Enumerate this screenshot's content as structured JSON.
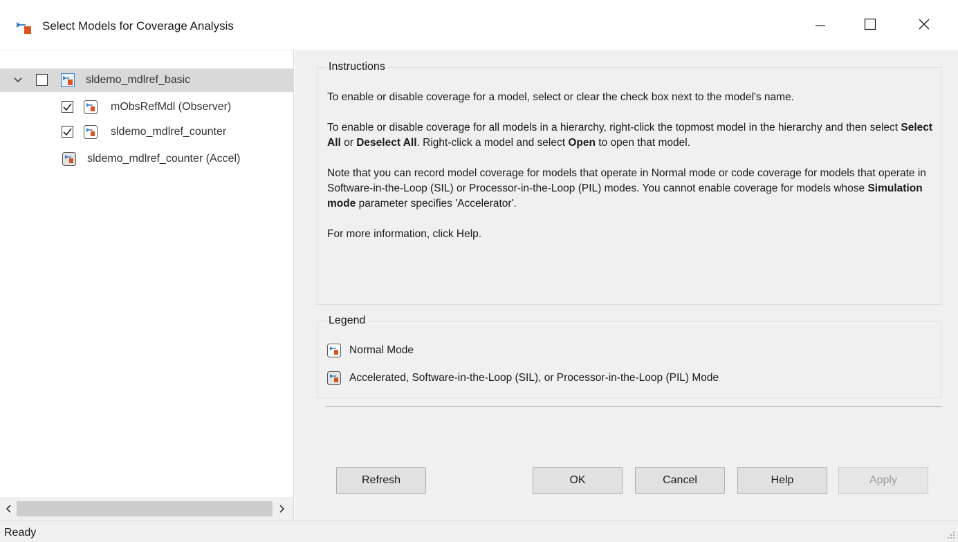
{
  "window": {
    "title": "Select Models for Coverage Analysis"
  },
  "tree": {
    "items": [
      {
        "label": "sldemo_mdlref_basic",
        "checked": false,
        "expanded": true,
        "mode": "normal",
        "selected": true
      },
      {
        "label": "mObsRefMdl (Observer)",
        "checked": true,
        "mode": "normal"
      },
      {
        "label": "sldemo_mdlref_counter",
        "checked": true,
        "mode": "normal"
      },
      {
        "label": "sldemo_mdlref_counter (Accel)",
        "checked": null,
        "mode": "accelerated"
      }
    ]
  },
  "instructions": {
    "title": "Instructions",
    "p1": "To enable or disable coverage for a model, select or clear the check box next to the model's name.",
    "p2_a": "To enable or disable coverage for all models in a hierarchy, right-click the topmost model in the hierarchy and then select ",
    "p2_b1": "Select All",
    "p2_c": " or ",
    "p2_b2": "Deselect All",
    "p2_d": ". Right-click a model and select ",
    "p2_b3": "Open",
    "p2_e": " to open that model.",
    "p3_a": "Note that you can record model coverage for models that operate in Normal mode or code coverage for models that operate in Software-in-the-Loop (SIL) or Processor-in-the-Loop (PIL) modes. You cannot enable coverage for models whose ",
    "p3_b": "Simulation mode",
    "p3_c": " parameter specifies 'Accelerator'.",
    "p4": "For more information, click Help."
  },
  "legend": {
    "title": "Legend",
    "normal": "Normal Mode",
    "accelerated": "Accelerated, Software-in-the-Loop (SIL), or Processor-in-the-Loop (PIL) Mode"
  },
  "buttons": {
    "refresh": "Refresh",
    "ok": "OK",
    "cancel": "Cancel",
    "help": "Help",
    "apply": "Apply"
  },
  "status": {
    "text": "Ready"
  },
  "colors": {
    "model_icon_blue": "#3d7fc1",
    "model_icon_orange": "#d9541e",
    "selection": "#d9d9d9",
    "panel_bg": "#f0f0f0"
  },
  "icons": [
    "app-icon",
    "minimize-icon",
    "maximize-icon",
    "close-icon",
    "chevron-down-icon",
    "model-icon",
    "scroll-left-icon",
    "scroll-right-icon",
    "resize-grip-icon"
  ]
}
